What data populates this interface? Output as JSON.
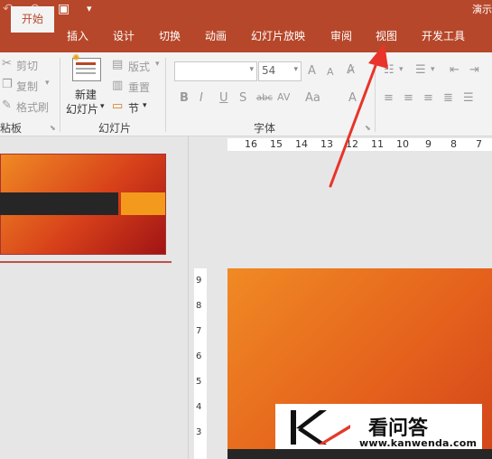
{
  "title_bar": {
    "doc_title": "演示",
    "qa_undo": "↶",
    "qa_redo": "↷",
    "qa_slideshow": "▣",
    "qa_more": "▾"
  },
  "tabs": [
    {
      "label": "开始",
      "active": true
    },
    {
      "label": "插入"
    },
    {
      "label": "设计"
    },
    {
      "label": "切换"
    },
    {
      "label": "动画"
    },
    {
      "label": "幻灯片放映"
    },
    {
      "label": "审阅"
    },
    {
      "label": "视图"
    },
    {
      "label": "开发工具"
    }
  ],
  "ribbon": {
    "clipboard": {
      "cut": "剪切",
      "copy": "复制",
      "format_painter": "格式刷",
      "group_label": "粘板"
    },
    "slides": {
      "new_slide_line1": "新建",
      "new_slide_line2": "幻灯片",
      "layout": "版式",
      "reset": "重置",
      "section": "节",
      "group_label": "幻灯片"
    },
    "font": {
      "font_name": "",
      "font_size": "54",
      "group_label": "字体",
      "bold": "B",
      "italic": "I",
      "underline": "U",
      "shadow": "S",
      "strike": "abc",
      "spacing": "AV",
      "case": "Aa",
      "color": "A",
      "grow": "A",
      "shrink": "A"
    }
  },
  "ruler": {
    "h_ticks": [
      "16",
      "15",
      "14",
      "13",
      "12",
      "11",
      "10",
      "9",
      "8",
      "7"
    ],
    "v_ticks": [
      "9",
      "8",
      "7",
      "6",
      "5",
      "4",
      "3"
    ]
  },
  "watermark": {
    "name": "看问答",
    "url": "www.kanwenda.com"
  }
}
